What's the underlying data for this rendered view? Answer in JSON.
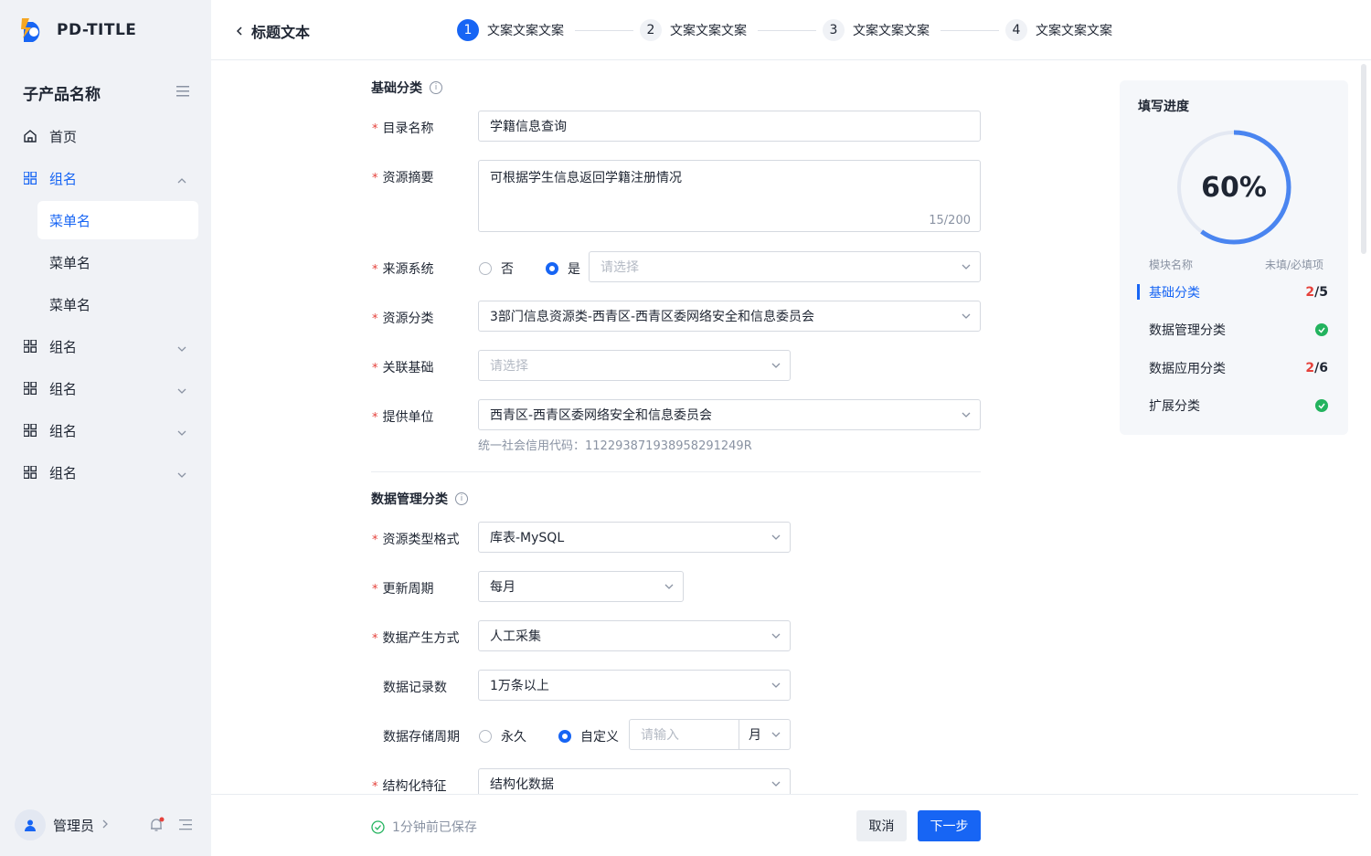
{
  "app": {
    "logo_text": "PD-TITLE",
    "product_title": "子产品名称"
  },
  "sidebar": {
    "items": [
      {
        "label": "首页",
        "icon": "home-icon"
      },
      {
        "label": "组名",
        "icon": "grid-icon",
        "expanded": true
      },
      {
        "label": "组名",
        "icon": "grid-icon"
      },
      {
        "label": "组名",
        "icon": "grid-icon"
      },
      {
        "label": "组名",
        "icon": "grid-icon"
      },
      {
        "label": "组名",
        "icon": "grid-icon"
      }
    ],
    "sub_items": [
      "菜单名",
      "菜单名",
      "菜单名"
    ],
    "user_name": "管理员"
  },
  "header": {
    "title": "标题文本",
    "steps": [
      {
        "num": "1",
        "label": "文案文案文案"
      },
      {
        "num": "2",
        "label": "文案文案文案"
      },
      {
        "num": "3",
        "label": "文案文案文案"
      },
      {
        "num": "4",
        "label": "文案文案文案"
      }
    ]
  },
  "form": {
    "section1": "基础分类",
    "catalog_name": {
      "label": "目录名称",
      "value": "学籍信息查询"
    },
    "summary": {
      "label": "资源摘要",
      "value": "可根据学生信息返回学籍注册情况",
      "counter": "15/200"
    },
    "source_system": {
      "label": "来源系统",
      "opt_no": "否",
      "opt_yes": "是",
      "placeholder": "请选择"
    },
    "resource_category": {
      "label": "资源分类",
      "value": "3部门信息资源类-西青区-西青区委网络安全和信息委员会"
    },
    "related_base": {
      "label": "关联基础",
      "placeholder": "请选择"
    },
    "provider": {
      "label": "提供单位",
      "value": "西青区-西青区委网络安全和信息委员会",
      "helper": "统一社会信用代码：112293871938958291249R"
    },
    "section2": "数据管理分类",
    "resource_format": {
      "label": "资源类型格式",
      "value": "库表-MySQL"
    },
    "update_cycle": {
      "label": "更新周期",
      "value": "每月"
    },
    "data_origin": {
      "label": "数据产生方式",
      "value": "人工采集"
    },
    "record_count": {
      "label": "数据记录数",
      "value": "1万条以上"
    },
    "storage_cycle": {
      "label": "数据存储周期",
      "opt_forever": "永久",
      "opt_custom": "自定义",
      "placeholder": "请输入",
      "unit": "月"
    },
    "structure": {
      "label": "结构化特征",
      "value": "结构化数据"
    }
  },
  "footer": {
    "saved_text": "1分钟前已保存",
    "cancel": "取消",
    "next": "下一步"
  },
  "progress": {
    "title": "填写进度",
    "percent_text": "60%",
    "percent": 60,
    "col_module": "模块名称",
    "col_count": "未填/必填项",
    "rows": [
      {
        "label": "基础分类",
        "filled": "2",
        "total": "/5"
      },
      {
        "label": "数据管理分类"
      },
      {
        "label": "数据应用分类",
        "filled": "2",
        "total": "/6"
      },
      {
        "label": "扩展分类"
      }
    ]
  },
  "colors": {
    "accent": "#1765f4",
    "required": "#e5413b",
    "success": "#23b35e"
  }
}
